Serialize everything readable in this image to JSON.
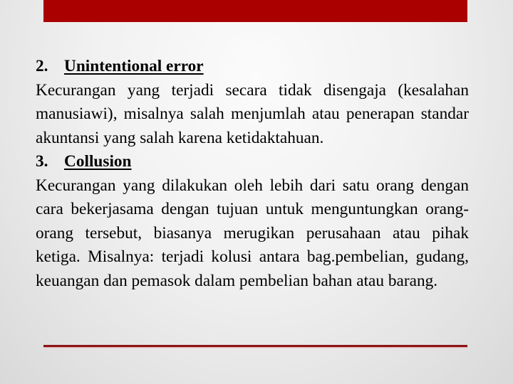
{
  "colors": {
    "accent_bar": "#ab0000",
    "bottom_rule": "#8e1414"
  },
  "sections": [
    {
      "number": "2.",
      "title": "Unintentional error",
      "body": "Kecurangan yang terjadi secara tidak disengaja (kesalahan manusiawi), misalnya salah menjumlah atau penerapan standar akuntansi yang salah karena ketidaktahuan."
    },
    {
      "number": "3.",
      "title": "Collusion",
      "body": "Kecurangan yang dilakukan oleh lebih dari satu orang dengan cara bekerjasama dengan tujuan untuk menguntungkan orang-orang tersebut, biasanya merugikan perusahaan atau pihak ketiga. Misalnya: terjadi kolusi antara bag.pembelian, gudang, keuangan dan pemasok dalam pembelian bahan atau barang."
    }
  ]
}
